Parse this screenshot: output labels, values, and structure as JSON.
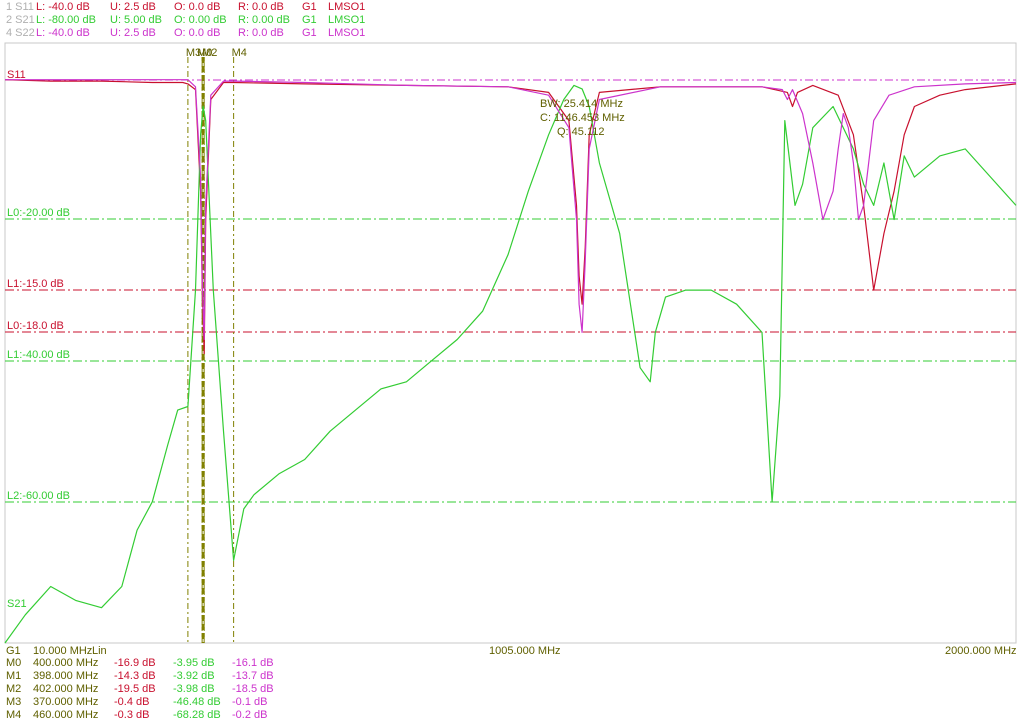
{
  "colors": {
    "s11": "#c8102e",
    "s21": "#33cc33",
    "s22": "#cc33cc",
    "marker": "#808000",
    "label": "#606000",
    "grid_frame": "#c8c8c8",
    "ref": "#cc33cc"
  },
  "header": [
    {
      "id": "1 S11",
      "L": "L: -40.0 dB",
      "U": "U: 2.5 dB",
      "O": "O: 0.0 dB",
      "R": "R: 0.0 dB",
      "G": "G1",
      "cal": "LMSO1"
    },
    {
      "id": "2 S21",
      "L": "L: -80.00 dB",
      "U": "U: 5.00 dB",
      "O": "O: 0.00 dB",
      "R": "R: 0.00 dB",
      "G": "G1",
      "cal": "LMSO1"
    },
    {
      "id": "4 S22",
      "L": "L: -40.0 dB",
      "U": "U: 2.5 dB",
      "O": "O: 0.0 dB",
      "R": "R: 0.0 dB",
      "G": "G1",
      "cal": "LMSO1"
    }
  ],
  "trace_labels": {
    "s11": "S11",
    "s21": "S21"
  },
  "limit_lines": [
    {
      "label": "L0:-20.00 dB",
      "trace": "s21",
      "value": -20
    },
    {
      "label": "L1:-15.0 dB",
      "trace": "s11",
      "value": -15
    },
    {
      "label": "L0:-18.0 dB",
      "trace": "s11",
      "value": -18
    },
    {
      "label": "L1:-40.00 dB",
      "trace": "s21",
      "value": -40
    },
    {
      "label": "L2:-60.00 dB",
      "trace": "s21",
      "value": -60
    }
  ],
  "marker_labels": [
    "M3",
    "M0",
    "M2",
    "M4"
  ],
  "bw_box": {
    "bw": "BW: 25.414 MHz",
    "c": "C: 1146.453 MHz",
    "q": "Q: 45.112"
  },
  "xaxis": {
    "group": "G1",
    "start": "10.000 MHz",
    "scale": "Lin",
    "center": "1005.000 MHz",
    "stop": "2000.000 MHz"
  },
  "markers": [
    {
      "name": "M0",
      "freq": "400.000 MHz",
      "s11": "-16.9 dB",
      "s21": "-3.95 dB",
      "s22": "-16.1 dB"
    },
    {
      "name": "M1",
      "freq": "398.000 MHz",
      "s11": "-14.3 dB",
      "s21": "-3.92 dB",
      "s22": "-13.7 dB"
    },
    {
      "name": "M2",
      "freq": "402.000 MHz",
      "s11": "-19.5 dB",
      "s21": "-3.98 dB",
      "s22": "-18.5 dB"
    },
    {
      "name": "M3",
      "freq": "370.000 MHz",
      "s11": "-0.4 dB",
      "s21": "-46.48 dB",
      "s22": "-0.1 dB"
    },
    {
      "name": "M4",
      "freq": "460.000 MHz",
      "s11": "-0.3 dB",
      "s21": "-68.28 dB",
      "s22": "-0.2 dB"
    }
  ],
  "chart_data": {
    "type": "line",
    "xlim": [
      10,
      2000
    ],
    "xunit": "MHz",
    "series": [
      {
        "name": "S11",
        "ylim": [
          -40,
          2.5
        ],
        "x": [
          10,
          100,
          200,
          300,
          340,
          360,
          370,
          385,
          395,
          398,
          400,
          402,
          405,
          415,
          440,
          460,
          600,
          800,
          1000,
          1080,
          1120,
          1135,
          1140,
          1146,
          1152,
          1160,
          1180,
          1300,
          1500,
          1550,
          1560,
          1570,
          1600,
          1650,
          1680,
          1700,
          1720,
          1740,
          1760,
          1780,
          1800,
          1850,
          1900,
          2000
        ],
        "y": [
          -0.1,
          -0.2,
          -0.2,
          -0.3,
          -0.3,
          -0.3,
          -0.4,
          -0.8,
          -8,
          -14.3,
          -16.9,
          -19.5,
          -10,
          -1.5,
          -0.3,
          -0.3,
          -0.4,
          -0.5,
          -0.6,
          -1.0,
          -3.0,
          -9,
          -14,
          -16,
          -12,
          -4,
          -1.0,
          -0.6,
          -0.6,
          -1.0,
          -2.0,
          -1.0,
          -0.5,
          -1.2,
          -4,
          -9,
          -15,
          -11,
          -8,
          -4,
          -2.0,
          -1.2,
          -0.8,
          -0.4
        ]
      },
      {
        "name": "S21",
        "ylim": [
          -80,
          5
        ],
        "x": [
          10,
          50,
          100,
          150,
          200,
          240,
          270,
          300,
          330,
          350,
          370,
          385,
          395,
          400,
          405,
          420,
          440,
          460,
          480,
          500,
          550,
          600,
          650,
          700,
          750,
          800,
          850,
          900,
          950,
          1000,
          1040,
          1080,
          1110,
          1130,
          1146,
          1160,
          1180,
          1220,
          1260,
          1280,
          1290,
          1310,
          1350,
          1400,
          1450,
          1500,
          1520,
          1535,
          1545,
          1555,
          1565,
          1580,
          1600,
          1640,
          1680,
          1700,
          1720,
          1740,
          1760,
          1780,
          1800,
          1850,
          1900,
          2000
        ],
        "y": [
          -80,
          -76,
          -72,
          -74,
          -75,
          -72,
          -64,
          -60,
          -52,
          -47,
          -46.5,
          -30,
          -8,
          -3.95,
          -6,
          -30,
          -50,
          -68.3,
          -61,
          -59,
          -56,
          -54,
          -50,
          -47,
          -44,
          -43,
          -40,
          -37,
          -33,
          -25,
          -16,
          -8,
          -3,
          -1.0,
          -1.5,
          -4,
          -12,
          -22,
          -41,
          -43,
          -36,
          -31,
          -30,
          -30,
          -32,
          -36,
          -60,
          -45,
          -6,
          -12,
          -18,
          -15,
          -7,
          -4,
          -10,
          -15,
          -18,
          -12,
          -20,
          -11,
          -14,
          -11,
          -10,
          -18
        ]
      },
      {
        "name": "S22",
        "ylim": [
          -40,
          2.5
        ],
        "x": [
          10,
          100,
          200,
          300,
          340,
          360,
          370,
          385,
          395,
          398,
          400,
          402,
          405,
          415,
          440,
          460,
          600,
          800,
          1000,
          1080,
          1120,
          1135,
          1140,
          1146,
          1152,
          1160,
          1180,
          1300,
          1500,
          1540,
          1550,
          1560,
          1580,
          1600,
          1620,
          1640,
          1650,
          1660,
          1670,
          1680,
          1690,
          1700,
          1720,
          1750,
          1800,
          1900,
          2000
        ],
        "y": [
          -0.1,
          -0.1,
          -0.1,
          -0.1,
          -0.1,
          -0.1,
          -0.1,
          -0.6,
          -7,
          -13.7,
          -16.1,
          -18.5,
          -9,
          -1.2,
          -0.2,
          -0.2,
          -0.3,
          -0.5,
          -0.6,
          -1.2,
          -3.5,
          -10,
          -16,
          -18,
          -13,
          -5,
          -1.5,
          -0.6,
          -0.6,
          -0.8,
          -1.5,
          -0.8,
          -2.5,
          -6,
          -10,
          -8,
          -5,
          -2.5,
          -3.5,
          -6,
          -10,
          -9,
          -3,
          -1.2,
          -0.6,
          -0.4,
          -0.3
        ]
      }
    ]
  }
}
